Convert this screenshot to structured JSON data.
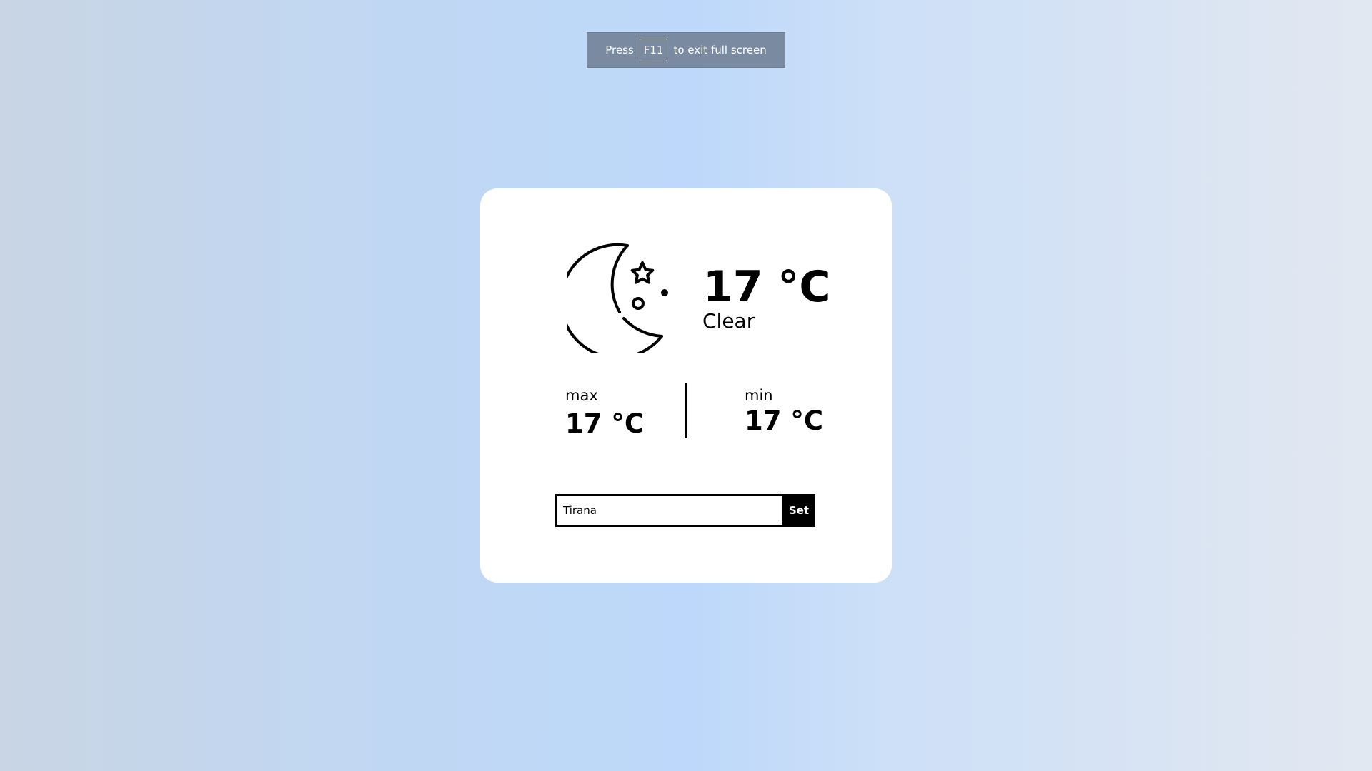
{
  "fullscreen_toast": {
    "prefix": "Press",
    "key": "F11",
    "suffix": "to exit full screen"
  },
  "weather": {
    "icon": "moon-stars-icon",
    "temperature": "17 °C",
    "condition": "Clear",
    "max_label": "max",
    "max_value": "17 °C",
    "min_label": "min",
    "min_value": "17 °C"
  },
  "city_form": {
    "city_value": "Tirana",
    "set_label": "Set"
  },
  "colors": {
    "card_background": "#ffffff",
    "accent": "#000000",
    "toast_background": "#7a8aa0"
  }
}
